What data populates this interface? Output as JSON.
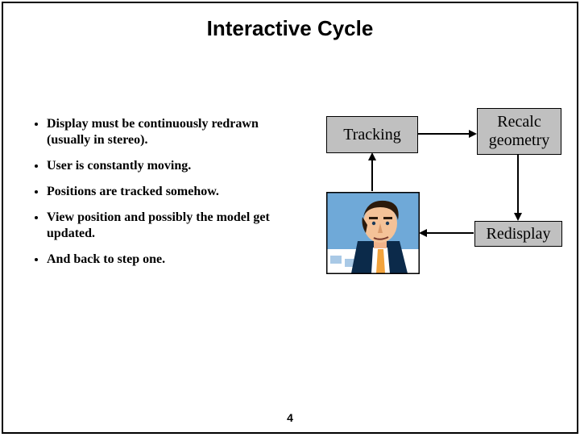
{
  "title": "Interactive Cycle",
  "bullets": [
    "Display must be continuously redrawn (usually in stereo).",
    "User is constantly moving.",
    "Positions are tracked somehow.",
    "View position and possibly the model get updated.",
    "And back to step one."
  ],
  "boxes": {
    "tracking": "Tracking",
    "recalc": "Recalc geometry",
    "redisplay": "Redisplay"
  },
  "illustration": "man-portrait-clipart",
  "page_number": "4"
}
